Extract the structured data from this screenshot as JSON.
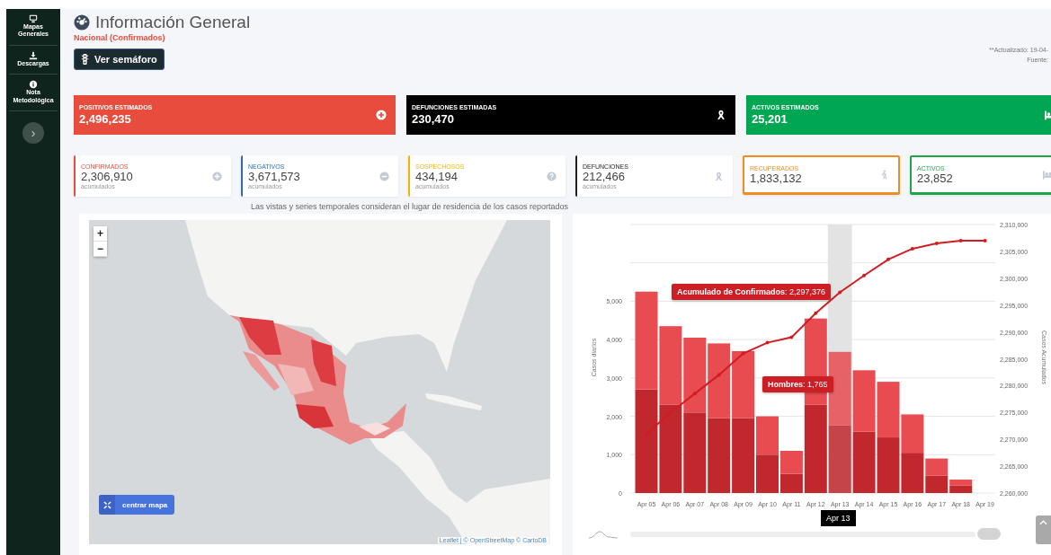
{
  "sidebar": {
    "items": [
      {
        "label": "Mapas Generales"
      },
      {
        "label": "Descargas"
      },
      {
        "label": "Nota Metodológica"
      }
    ],
    "toggle": "›"
  },
  "header": {
    "title": "Información General",
    "subtitle": "Nacional (Confirmados)",
    "semaforo_button": "Ver semáforo",
    "updated": "**Actualizado: 19-04-",
    "source": "Fuente:"
  },
  "estimated_cards": [
    {
      "label": "POSITIVOS ESTIMADOS",
      "value": "2,496,235",
      "color": "#e74c3c"
    },
    {
      "label": "DEFUNCIONES ESTIMADAS",
      "value": "230,470",
      "color": "#000000"
    },
    {
      "label": "ACTIVOS ESTIMADOS",
      "value": "25,201",
      "color": "#00a651"
    }
  ],
  "summary_cards": [
    {
      "kind": "side",
      "label": "CONFIRMADOS",
      "value": "2,306,910",
      "note": "acumulados",
      "color": "#e74c3c"
    },
    {
      "kind": "side",
      "label": "NEGATIVOS",
      "value": "3,671,573",
      "note": "acumulados",
      "color": "#2a6fb0"
    },
    {
      "kind": "side",
      "label": "SOSPECHOSOS",
      "value": "434,194",
      "note": "acumulados",
      "color": "#f4b400"
    },
    {
      "kind": "side",
      "label": "DEFUNCIONES",
      "value": "212,466",
      "note": "acumulados",
      "color": "#222222"
    },
    {
      "kind": "framed",
      "label": "RECUPERADOS",
      "value": "1,833,132",
      "color": "#ef8c22"
    },
    {
      "kind": "framed",
      "label": "ACTIVOS",
      "value": "23,852",
      "color": "#1fa64a"
    }
  ],
  "note": "Las vistas y series temporales consideran el lugar de residencia de los casos reportados",
  "map": {
    "zoom_in": "+",
    "zoom_out": "−",
    "center_button": "centrar mapa",
    "attribution": "Leaflet | © OpenStreetMap © CartoDB"
  },
  "chart": {
    "bars": {
      "chart_data": {
        "type": "bar",
        "ylabel": "Casos diarios",
        "categories": [
          "Apr 05",
          "Apr 06",
          "Apr 07",
          "Apr 08",
          "Apr 09",
          "Apr 10",
          "Apr 11",
          "Apr 12",
          "Apr 13",
          "Apr 14",
          "Apr 15",
          "Apr 16",
          "Apr 17",
          "Apr 18",
          "Apr 19"
        ],
        "series": [
          {
            "name": "Hombres",
            "color": "#c0282e",
            "values": [
              2700,
              2300,
              2100,
              1950,
              1950,
              1000,
              500,
              2300,
              1765,
              1600,
              1450,
              1050,
              450,
              200,
              0
            ]
          },
          {
            "color": "#e84b50",
            "values": [
              2550,
              2050,
              1950,
              1950,
              1750,
              1000,
              600,
              2250,
              1915,
              1600,
              1450,
              1000,
              450,
              150,
              0
            ]
          }
        ],
        "ylim": [
          0,
          7000
        ],
        "yticks": [
          0,
          {
            "value": 1000,
            "label": "1,000"
          },
          {
            "value": 2000,
            "label": "2,000"
          },
          {
            "value": 3000,
            "label": "3,000"
          },
          {
            "value": 4000,
            "label": "4,000"
          },
          {
            "value": 5000,
            "label": "5,000"
          }
        ],
        "stacked": true,
        "grid": true
      }
    },
    "cumulative": {
      "chart_data": {
        "type": "line",
        "ylabel": "Casos Acumulados",
        "series": [
          {
            "name": "Acumulado de Confirmados",
            "color": "#d01c22",
            "values": [
              2271000,
              2275000,
              2278500,
              2282000,
              2286000,
              2288000,
              2289000,
              2293500,
              2297376,
              2300500,
              2303500,
              2305500,
              2306500,
              2307000,
              2307000
            ]
          }
        ],
        "ylim": [
          2260000,
          2310000
        ],
        "yticks": [
          {
            "value": 2260000,
            "label": "2,260,000"
          },
          {
            "value": 2265000,
            "label": "2,265,000"
          },
          {
            "value": 2270000,
            "label": "2,270,000"
          },
          {
            "value": 2275000,
            "label": "2,275,000"
          },
          {
            "value": 2280000,
            "label": "2,280,000"
          },
          {
            "value": 2285000,
            "label": "2,285,000"
          },
          {
            "value": 2290000,
            "label": "2,290,000"
          },
          {
            "value": 2295000,
            "label": "2,295,000"
          },
          {
            "value": 2300000,
            "label": "2,300,000"
          },
          {
            "value": 2305000,
            "label": "2,305,000"
          },
          {
            "value": 2310000,
            "label": "2,310,000"
          }
        ]
      }
    },
    "tooltips": [
      {
        "value": ": 2,297,376"
      },
      {
        "value": ": 1,765"
      }
    ],
    "x_tooltip": "Apr 13"
  }
}
